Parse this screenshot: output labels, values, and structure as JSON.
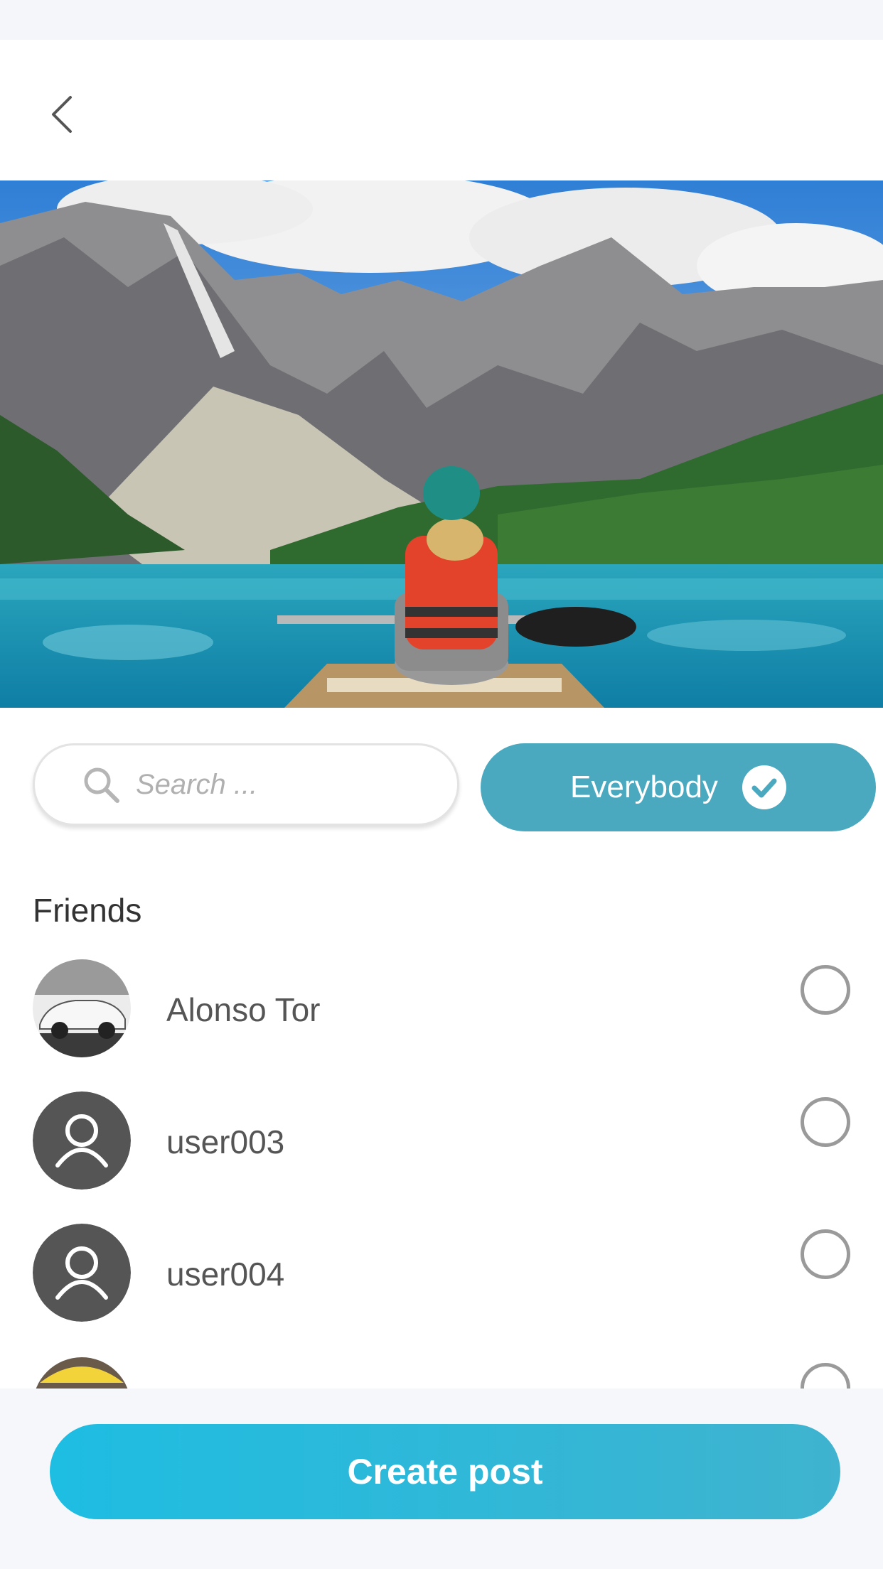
{
  "header": {
    "back_icon": "chevron-left-icon"
  },
  "hero": {
    "alt": "Woman in canoe on turquoise mountain lake"
  },
  "filter": {
    "search_placeholder": "Search ...",
    "search_icon": "search-icon",
    "audience_label": "Everybody",
    "audience_selected": true,
    "audience_icon": "check-circle-icon"
  },
  "friends": {
    "title": "Friends",
    "items": [
      {
        "name": "Alonso Tor",
        "avatar": "car-photo",
        "selected": false
      },
      {
        "name": "user003",
        "avatar": "default-user-icon",
        "selected": false
      },
      {
        "name": "user004",
        "avatar": "default-user-icon",
        "selected": false
      },
      {
        "name": "",
        "avatar": "umbrella-photo",
        "selected": false
      }
    ]
  },
  "footer": {
    "create_label": "Create post"
  },
  "colors": {
    "accent": "#4aa8bf",
    "button_start": "#1ebde2",
    "button_end": "#3fb3cf",
    "avatar_bg": "#555555"
  }
}
